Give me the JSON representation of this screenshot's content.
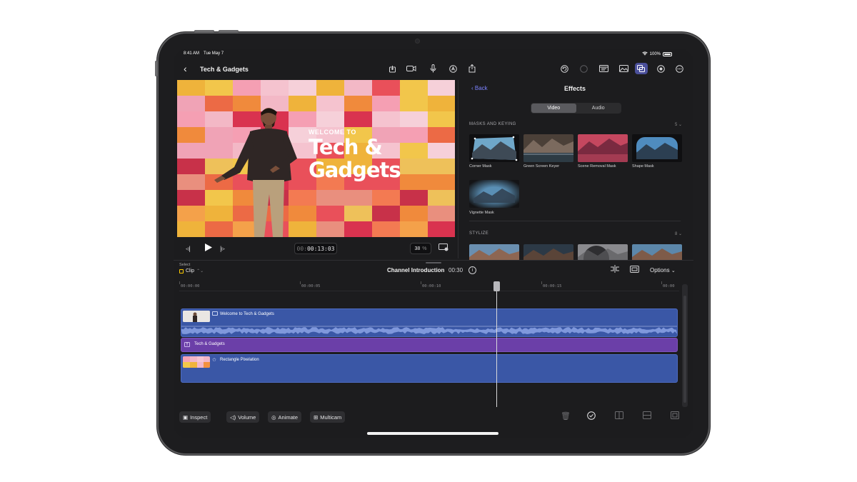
{
  "status": {
    "time": "8:41 AM",
    "date": "Tue May 7",
    "battery": "100%"
  },
  "toolbar": {
    "project_title": "Tech & Gadgets",
    "center_icons": [
      "export-icon",
      "camera-icon",
      "microphone-icon",
      "markup-icon",
      "share-icon"
    ],
    "right_icons": [
      "undo-icon",
      "redo-icon",
      "browser-icon",
      "photos-icon",
      "effects-icon",
      "color-icon",
      "more-icon"
    ]
  },
  "viewer": {
    "welcome": "WELCOME TO",
    "headline_line1": "Tech &",
    "headline_line2": "Gadgets",
    "timecode_dim": "00:",
    "timecode": "00:13:03",
    "zoom": "38",
    "zoom_unit": "%"
  },
  "effects": {
    "back_label": "Back",
    "title": "Effects",
    "tabs": [
      {
        "label": "Video",
        "selected": true
      },
      {
        "label": "Audio",
        "selected": false
      }
    ],
    "sections": [
      {
        "header": "MASKS AND KEYING",
        "count": "5",
        "items": [
          "Corner Mask",
          "Green Screen Keyer",
          "Scene Removal Mask",
          "Shape Mask",
          "Vignette Mask"
        ]
      },
      {
        "header": "STYLIZE",
        "count": "8"
      }
    ]
  },
  "timeline": {
    "select_label": "Select",
    "select_value": "Clip",
    "project_name": "Channel Introduction",
    "duration": "00:30",
    "options_label": "Options",
    "ruler": [
      "00:00:00",
      "00:00:05",
      "00:00:10",
      "00:00:15",
      "00:00"
    ],
    "clips": {
      "main": "Welcome to Tech & Gadgets",
      "title": "Tech & Gadgets",
      "background": "Rectangle Pixelation"
    }
  },
  "bottom": {
    "inspect": "Inspect",
    "volume": "Volume",
    "animate": "Animate",
    "multicam": "Multicam"
  },
  "colors": {
    "accent": "#7d83ff",
    "clip_blue": "#3a57a6",
    "clip_purple": "#6b3fa8",
    "background": "#1c1c1e"
  }
}
